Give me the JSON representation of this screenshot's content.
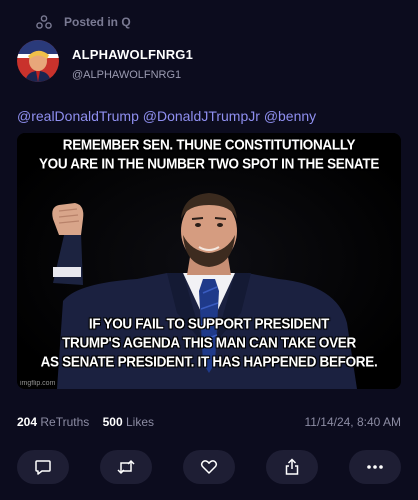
{
  "context": {
    "label": "Posted in Q",
    "icon": "group-icon"
  },
  "author": {
    "display_name": "ALPHAWOLFNRG1",
    "handle": "@ALPHAWOLFNRG1"
  },
  "post": {
    "mentions": [
      "@realDonaldTrump",
      "@DonaldJTrumpJr",
      "@benny"
    ],
    "image": {
      "top_caption_line1": "REMEMBER SEN. THUNE CONSTITUTIONALLY",
      "top_caption_line2": "YOU ARE IN THE NUMBER TWO SPOT IN THE SENATE",
      "bottom_caption_line1": "IF YOU FAIL TO SUPPORT PRESIDENT",
      "bottom_caption_line2": "TRUMP'S AGENDA THIS MAN CAN TAKE OVER",
      "bottom_caption_line3": "AS SENATE PRESIDENT. IT HAS HAPPENED BEFORE.",
      "watermark": "imgflip.com"
    }
  },
  "stats": {
    "retruths_count": "204",
    "retruths_label": "ReTruths",
    "likes_count": "500",
    "likes_label": "Likes",
    "timestamp": "11/14/24, 8:40 AM"
  },
  "actions": [
    {
      "name": "reply",
      "icon": "comment-icon"
    },
    {
      "name": "retruth",
      "icon": "repost-icon"
    },
    {
      "name": "like",
      "icon": "heart-icon"
    },
    {
      "name": "share",
      "icon": "share-icon"
    },
    {
      "name": "more",
      "icon": "more-icon"
    }
  ],
  "colors": {
    "background": "#0c0c1e",
    "accent": "#8f8ff0",
    "muted": "#8c8ca3",
    "button_bg": "#1e1e34"
  }
}
